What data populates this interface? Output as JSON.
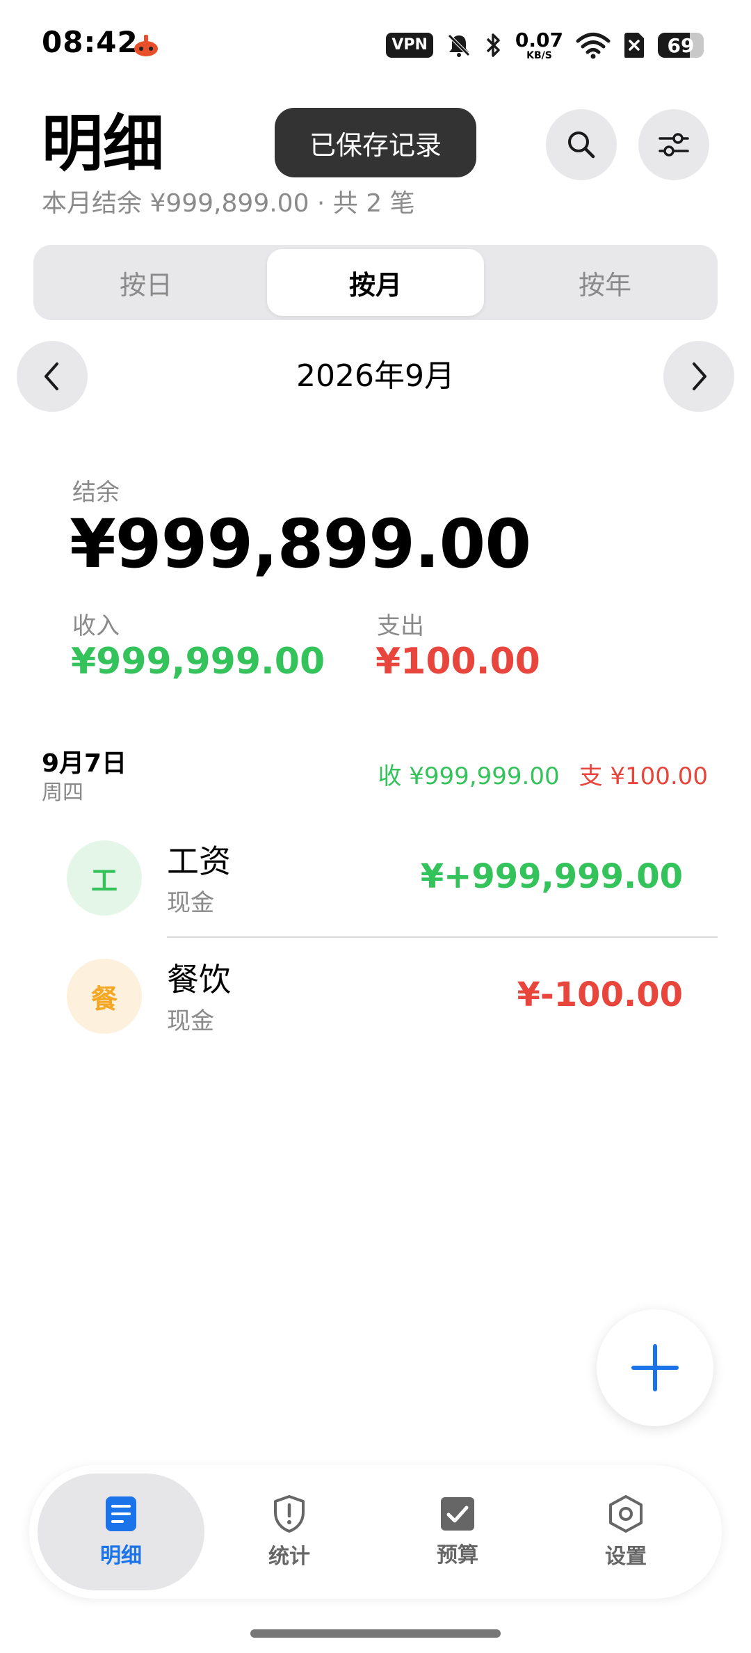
{
  "status_bar": {
    "time": "08:42",
    "vpn": "VPN",
    "net_speed_value": "0.07",
    "net_speed_unit": "KB/S",
    "battery": "69",
    "battery_level": 0.69
  },
  "header": {
    "title": "明细",
    "subtitle": "本月结余 ¥999,899.00 · 共 2 笔",
    "toast": "已保存记录",
    "search_icon": "search-icon",
    "filter_icon": "sliders-icon"
  },
  "segmented": {
    "items": [
      "按日",
      "按月",
      "按年"
    ],
    "selected": "按月"
  },
  "period": {
    "label": "2026年9月"
  },
  "summary": {
    "balance_label": "结余",
    "balance": "¥999,899.00",
    "income_label": "收入",
    "income": "¥999,999.00",
    "expense_label": "支出",
    "expense": "¥100.00"
  },
  "day_group": {
    "date": "9月7日",
    "weekday": "周四",
    "income_total": "收 ¥999,999.00",
    "expense_total": "支 ¥100.00"
  },
  "transactions": [
    {
      "icon_char": "工",
      "name": "工资",
      "account": "现金",
      "amount": "¥+999,999.00",
      "color": "#34c25a",
      "icon_bg": "#e3f6e8"
    },
    {
      "icon_char": "餐",
      "name": "餐饮",
      "account": "现金",
      "amount": "¥-100.00",
      "color": "#e8453c",
      "icon_bg": "#fdf0dc",
      "icon_color": "#f5a623"
    }
  ],
  "tabs": [
    {
      "label": "明细",
      "icon": "document-icon",
      "active": true
    },
    {
      "label": "统计",
      "icon": "shield-alert-icon",
      "active": false
    },
    {
      "label": "预算",
      "icon": "checkbox-icon",
      "active": false
    },
    {
      "label": "设置",
      "icon": "hexagon-gear-icon",
      "active": false
    }
  ],
  "colors": {
    "income": "#34c25a",
    "expense": "#e8453c",
    "accent": "#1a73e8",
    "toast_bg": "#333333"
  }
}
